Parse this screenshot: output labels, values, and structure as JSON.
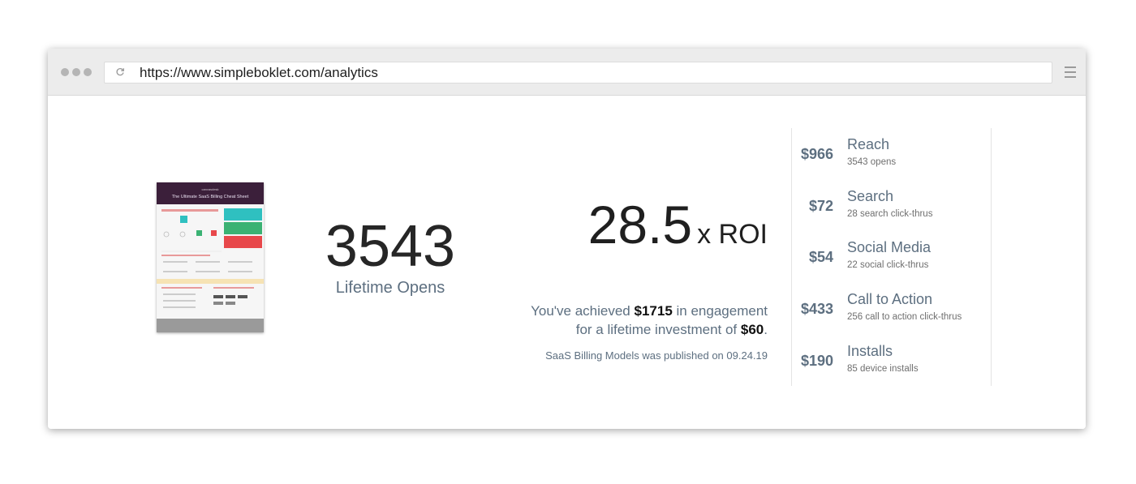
{
  "browser": {
    "url": "https://www.simpleboklet.com/analytics"
  },
  "booklet": {
    "brand": "canvasdesk",
    "title": "The Ultimate SaaS Billing Cheat Sheet",
    "accent_colors": [
      "#3b1f3a",
      "#2fc0c0",
      "#3bb273",
      "#e8484b"
    ]
  },
  "opens": {
    "count": "3543",
    "label": "Lifetime Opens"
  },
  "roi": {
    "value": "28.5",
    "unit": "x ROI",
    "achieved_prefix": "You've achieved",
    "achieved_amount": "$1715",
    "achieved_suffix": "in engagement",
    "investment_prefix": "for a lifetime investment of",
    "investment_amount": "$60",
    "investment_suffix": ".",
    "published": "SaaS Billing Models was published on 09.24.19"
  },
  "metrics": [
    {
      "amount": "$966",
      "name": "Reach",
      "sub": "3543 opens"
    },
    {
      "amount": "$72",
      "name": "Search",
      "sub": "28 search click-thrus"
    },
    {
      "amount": "$54",
      "name": "Social Media",
      "sub": "22 social click-thrus"
    },
    {
      "amount": "$433",
      "name": "Call to Action",
      "sub": "256 call to action click-thrus"
    },
    {
      "amount": "$190",
      "name": "Installs",
      "sub": "85 device installs"
    }
  ]
}
